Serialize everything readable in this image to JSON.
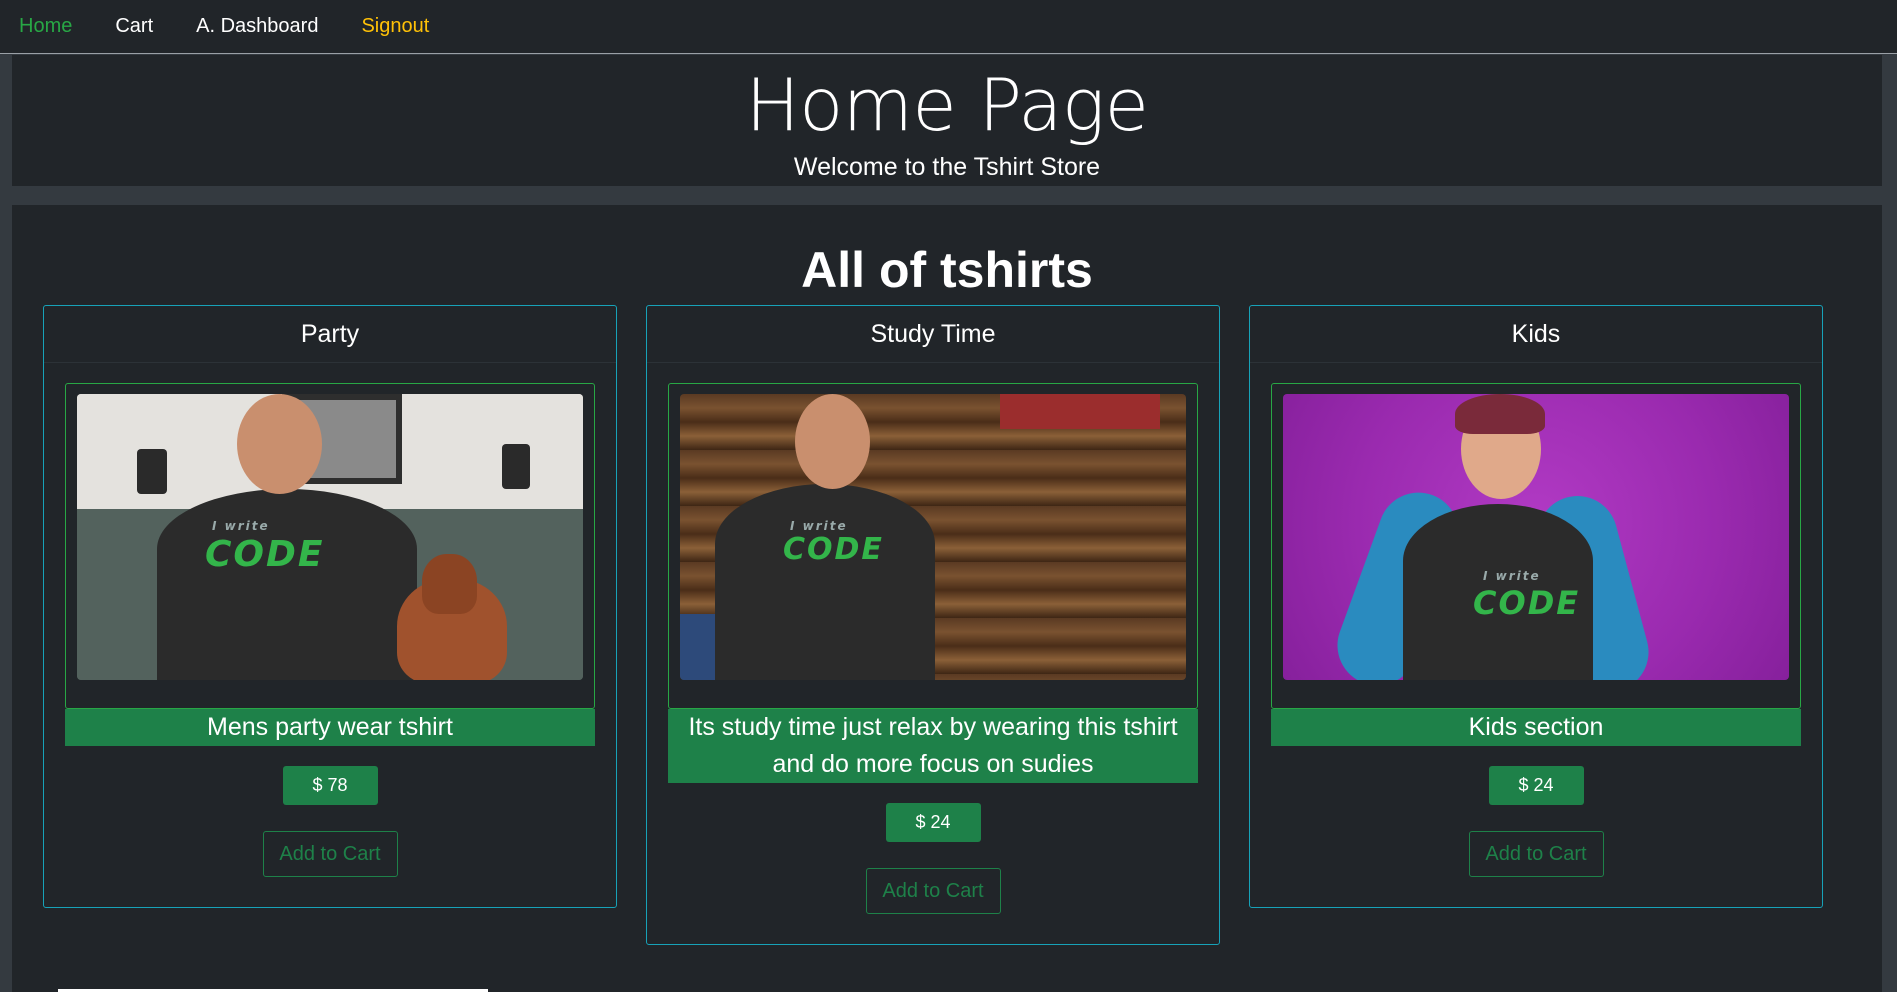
{
  "nav": {
    "home": "Home",
    "cart": "Cart",
    "dashboard": "A. Dashboard",
    "signout": "Signout"
  },
  "hero": {
    "title": "Home Page",
    "subtitle": "Welcome to the Tshirt Store"
  },
  "section": {
    "title": "All of tshirts"
  },
  "products": [
    {
      "name": "Party",
      "description": "Mens party wear tshirt",
      "price": "$ 78",
      "button": "Add to Cart"
    },
    {
      "name": "Study Time",
      "description": "Its study time just relax by wearing this tshirt and do more focus on sudies",
      "price": "$ 24",
      "button": "Add to Cart"
    },
    {
      "name": "Kids",
      "description": "Kids section",
      "price": "$ 24",
      "button": "Add to Cart"
    }
  ],
  "print": {
    "small": "I write",
    "big": "CODE"
  },
  "colors": {
    "active_nav": "#28a745",
    "signout": "#ffc107",
    "card_border": "#17a2b8",
    "accent_green": "#1e8149"
  }
}
